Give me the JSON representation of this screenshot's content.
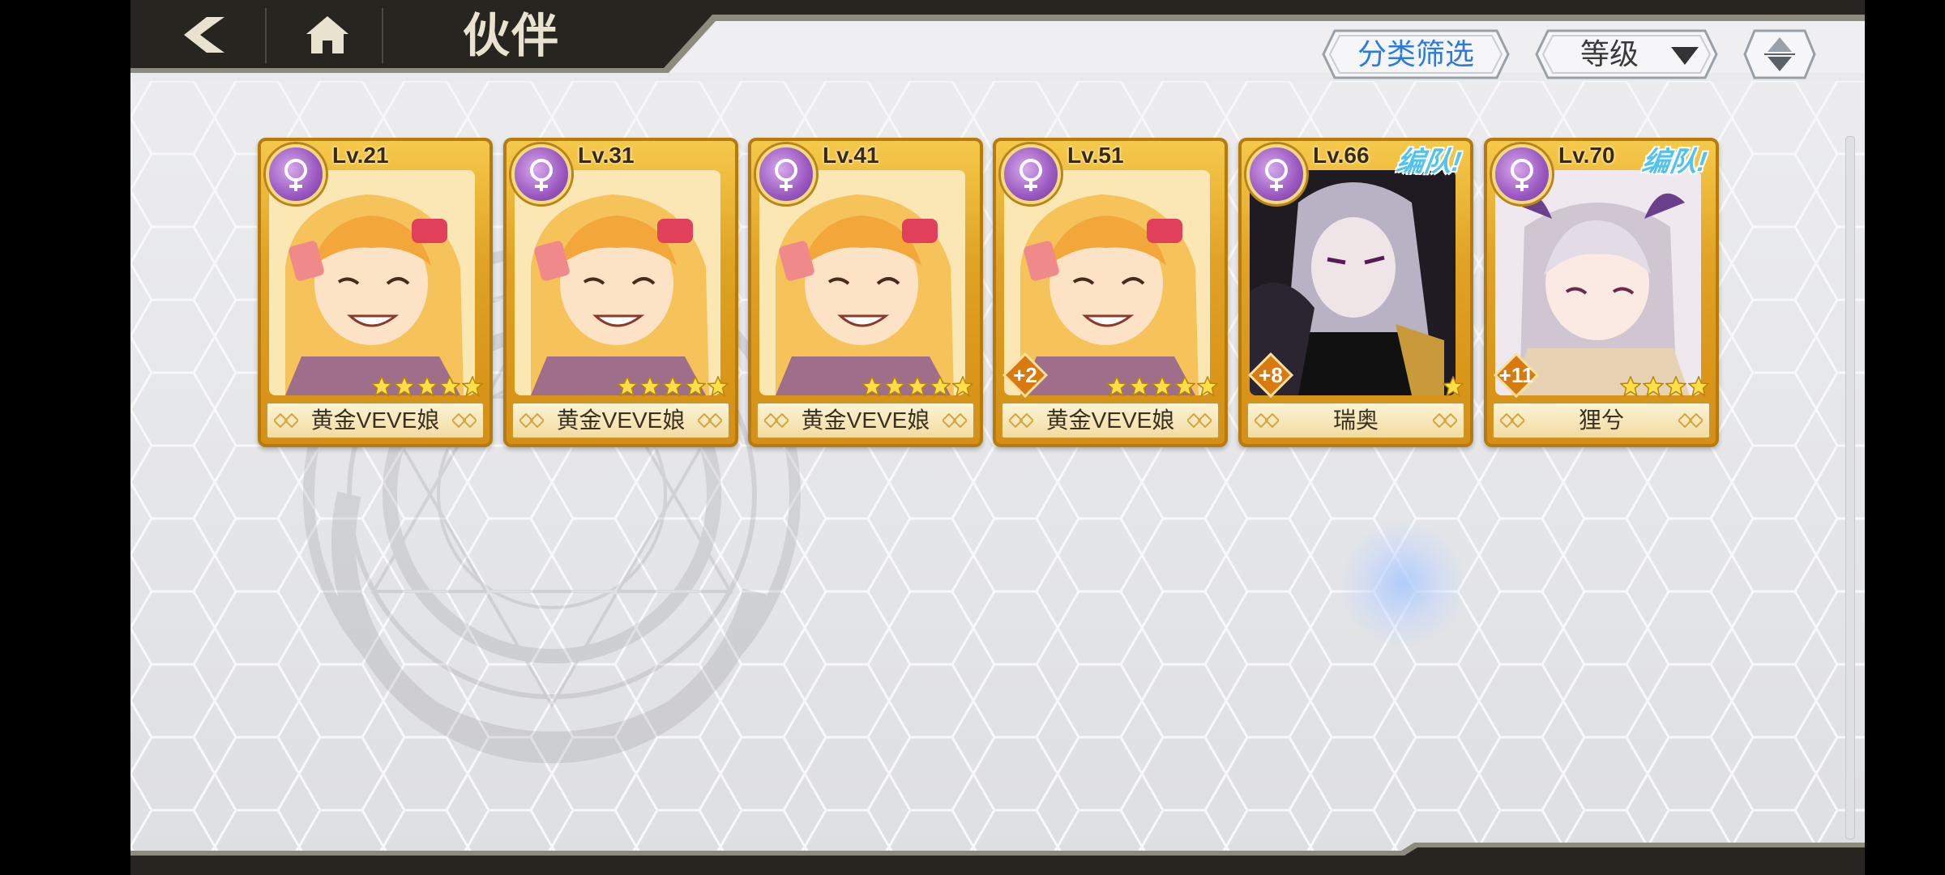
{
  "header": {
    "title": "伙伴",
    "back_icon": "back-arrow-icon",
    "home_icon": "home-icon"
  },
  "controls": {
    "filter_label": "分类筛选",
    "sort_label": "等级",
    "order_icon": "sort-order-icon"
  },
  "colors": {
    "filter_text": "#2a7ae0",
    "card_gold": "#e0a225",
    "element_purple": "#9a58c0",
    "team_tag": "#52c4ec"
  },
  "cards": [
    {
      "level": "Lv.21",
      "name": "黄金VEVE娘",
      "stars": 5,
      "plus": "",
      "team": ""
    },
    {
      "level": "Lv.31",
      "name": "黄金VEVE娘",
      "stars": 5,
      "plus": "",
      "team": ""
    },
    {
      "level": "Lv.41",
      "name": "黄金VEVE娘",
      "stars": 5,
      "plus": "",
      "team": ""
    },
    {
      "level": "Lv.51",
      "name": "黄金VEVE娘",
      "stars": 5,
      "plus": "+2",
      "team": ""
    },
    {
      "level": "Lv.66",
      "name": "瑞奥",
      "stars": 1,
      "plus": "+8",
      "team": "编队!"
    },
    {
      "level": "Lv.70",
      "name": "狸兮",
      "stars": 4,
      "plus": "+11",
      "team": "编队!"
    }
  ]
}
